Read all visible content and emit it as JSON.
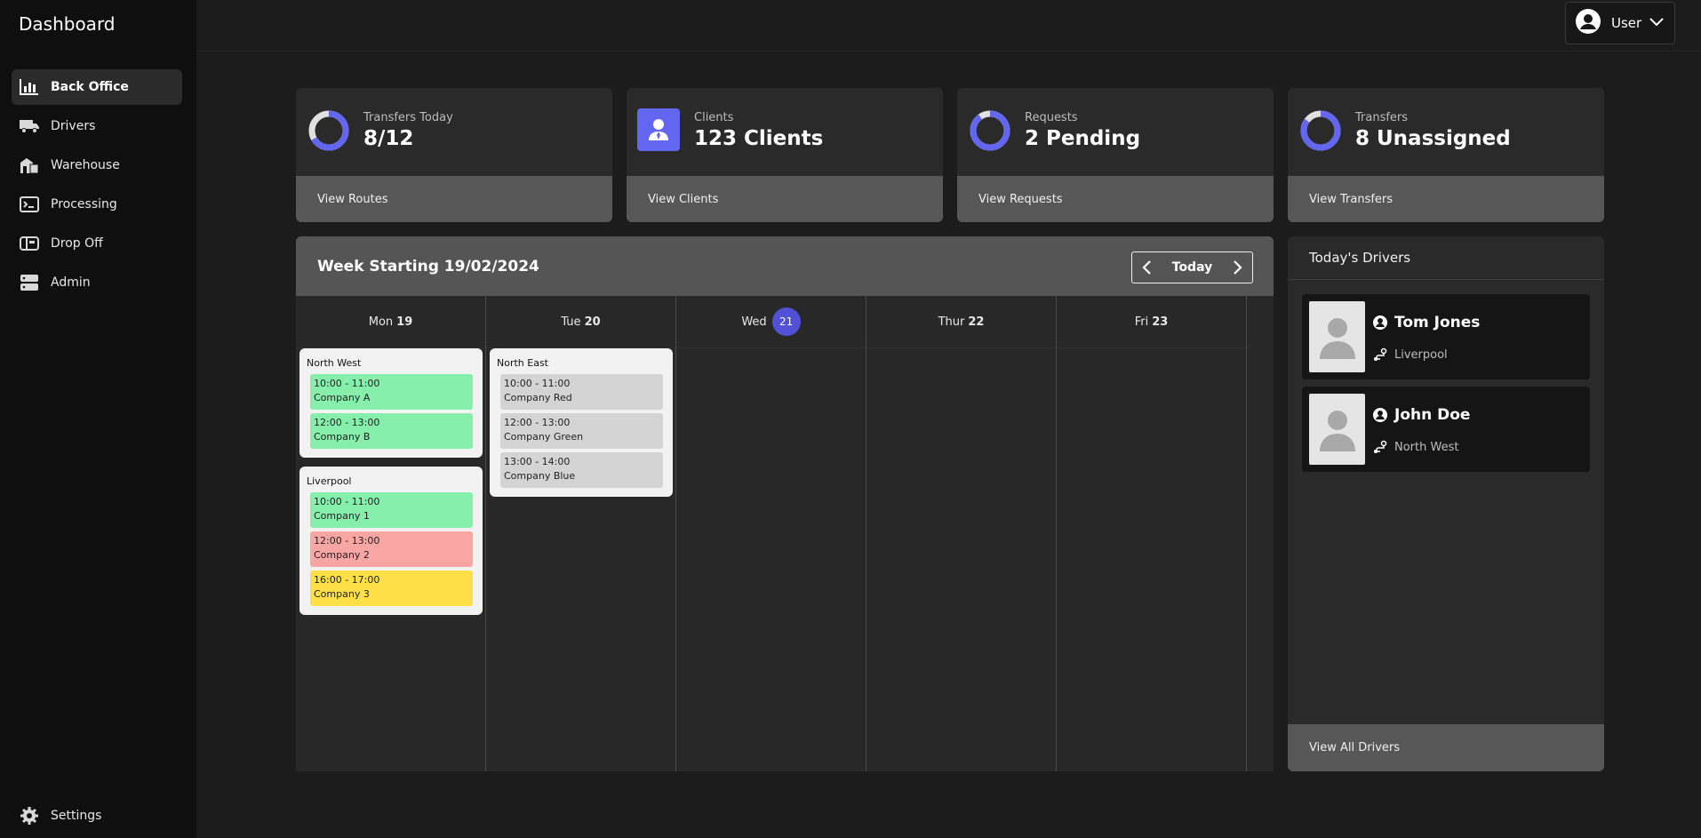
{
  "app": {
    "title": "Dashboard"
  },
  "sidebar": {
    "items": [
      {
        "label": "Back Office",
        "icon": "chart-bar-icon",
        "active": true
      },
      {
        "label": "Drivers",
        "icon": "van-icon"
      },
      {
        "label": "Warehouse",
        "icon": "warehouse-icon"
      },
      {
        "label": "Processing",
        "icon": "terminal-icon"
      },
      {
        "label": "Drop Off",
        "icon": "mailbox-icon"
      },
      {
        "label": "Admin",
        "icon": "server-icon"
      }
    ],
    "settings_label": "Settings"
  },
  "topbar": {
    "user_label": "User"
  },
  "stats": [
    {
      "label": "Transfers Today",
      "value": "8/12",
      "link": "View Routes",
      "icon": "donut-icon",
      "progress": 0.67
    },
    {
      "label": "Clients",
      "value": "123 Clients",
      "link": "View Clients",
      "icon": "client-icon"
    },
    {
      "label": "Requests",
      "value": "2 Pending",
      "link": "View Requests",
      "icon": "donut-icon",
      "progress": 0.9
    },
    {
      "label": "Transfers",
      "value": "8 Unassigned",
      "link": "View Transfers",
      "icon": "donut-icon",
      "progress": 0.85
    }
  ],
  "calendar": {
    "title": "Week Starting 19/02/2024",
    "today_label": "Today",
    "days": [
      {
        "name": "Mon",
        "num": "19"
      },
      {
        "name": "Tue",
        "num": "20"
      },
      {
        "name": "Wed",
        "num": "21",
        "today": true
      },
      {
        "name": "Thur",
        "num": "22"
      },
      {
        "name": "Fri",
        "num": "23"
      }
    ],
    "groups": {
      "mon": [
        {
          "title": "North West",
          "events": [
            {
              "time": "10:00 - 11:00",
              "company": "Company A",
              "color": "green"
            },
            {
              "time": "12:00 - 13:00",
              "company": "Company B",
              "color": "green"
            }
          ]
        },
        {
          "title": "Liverpool",
          "events": [
            {
              "time": "10:00 - 11:00",
              "company": "Company 1",
              "color": "green"
            },
            {
              "time": "12:00 - 13:00",
              "company": "Company 2",
              "color": "red"
            },
            {
              "time": "16:00 - 17:00",
              "company": "Company 3",
              "color": "yellow"
            }
          ]
        }
      ],
      "tue": [
        {
          "title": "North East",
          "events": [
            {
              "time": "10:00 - 11:00",
              "company": "Company Red",
              "color": "gray"
            },
            {
              "time": "12:00 - 13:00",
              "company": "Company Green",
              "color": "gray"
            },
            {
              "time": "13:00 - 14:00",
              "company": "Company Blue",
              "color": "gray"
            }
          ]
        }
      ]
    }
  },
  "drivers": {
    "title": "Today's Drivers",
    "list": [
      {
        "name": "Tom Jones",
        "location": "Liverpool"
      },
      {
        "name": "John Doe",
        "location": "North West"
      }
    ],
    "view_all": "View All Drivers"
  },
  "colors": {
    "accent": "#5150d6",
    "donut_track": "#e0e0e0",
    "donut_fill": "#6366f1"
  }
}
